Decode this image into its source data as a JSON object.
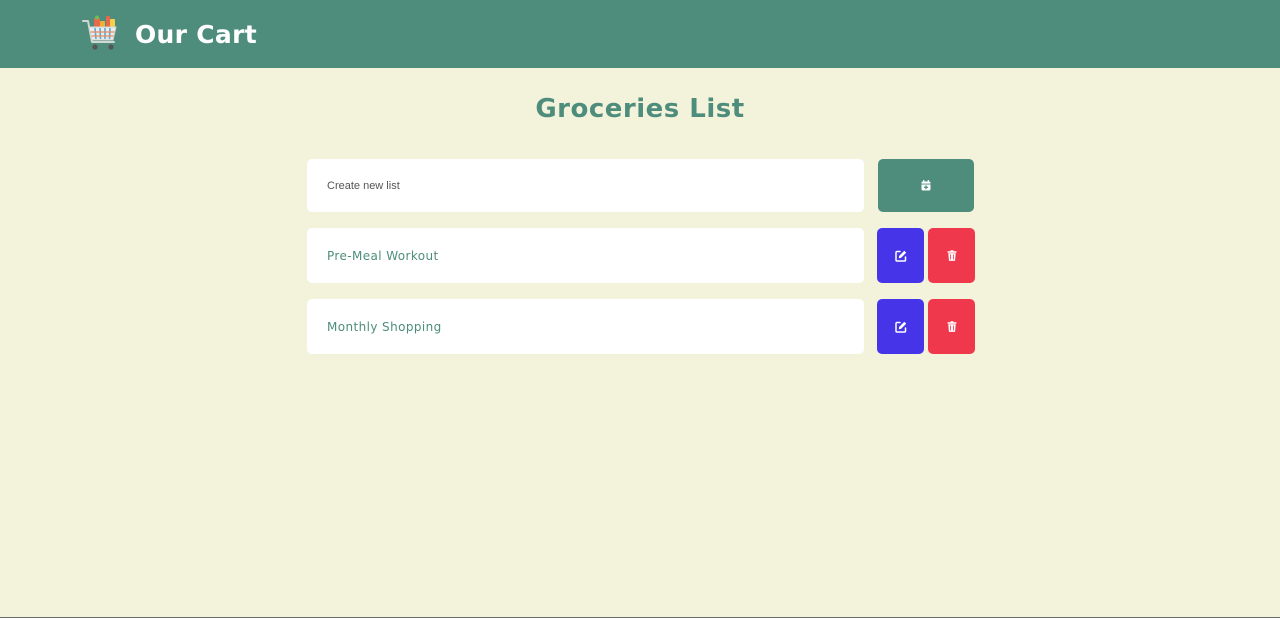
{
  "header": {
    "title": "Our Cart",
    "logo_icon": "shopping-cart-icon",
    "background_color": "#4e8d7c"
  },
  "main": {
    "title": "Groceries List",
    "create": {
      "placeholder": "Create new list",
      "value": "",
      "button_icon": "calendar-plus-icon"
    },
    "lists": [
      {
        "name": "Pre-Meal Workout",
        "edit_icon": "edit-icon",
        "delete_icon": "trash-icon"
      },
      {
        "name": "Monthly Shopping",
        "edit_icon": "edit-icon",
        "delete_icon": "trash-icon"
      }
    ]
  },
  "colors": {
    "background": "#f3f3dc",
    "accent": "#4e8d7c",
    "edit": "#4634e8",
    "delete": "#f0384c",
    "card": "#ffffff"
  }
}
